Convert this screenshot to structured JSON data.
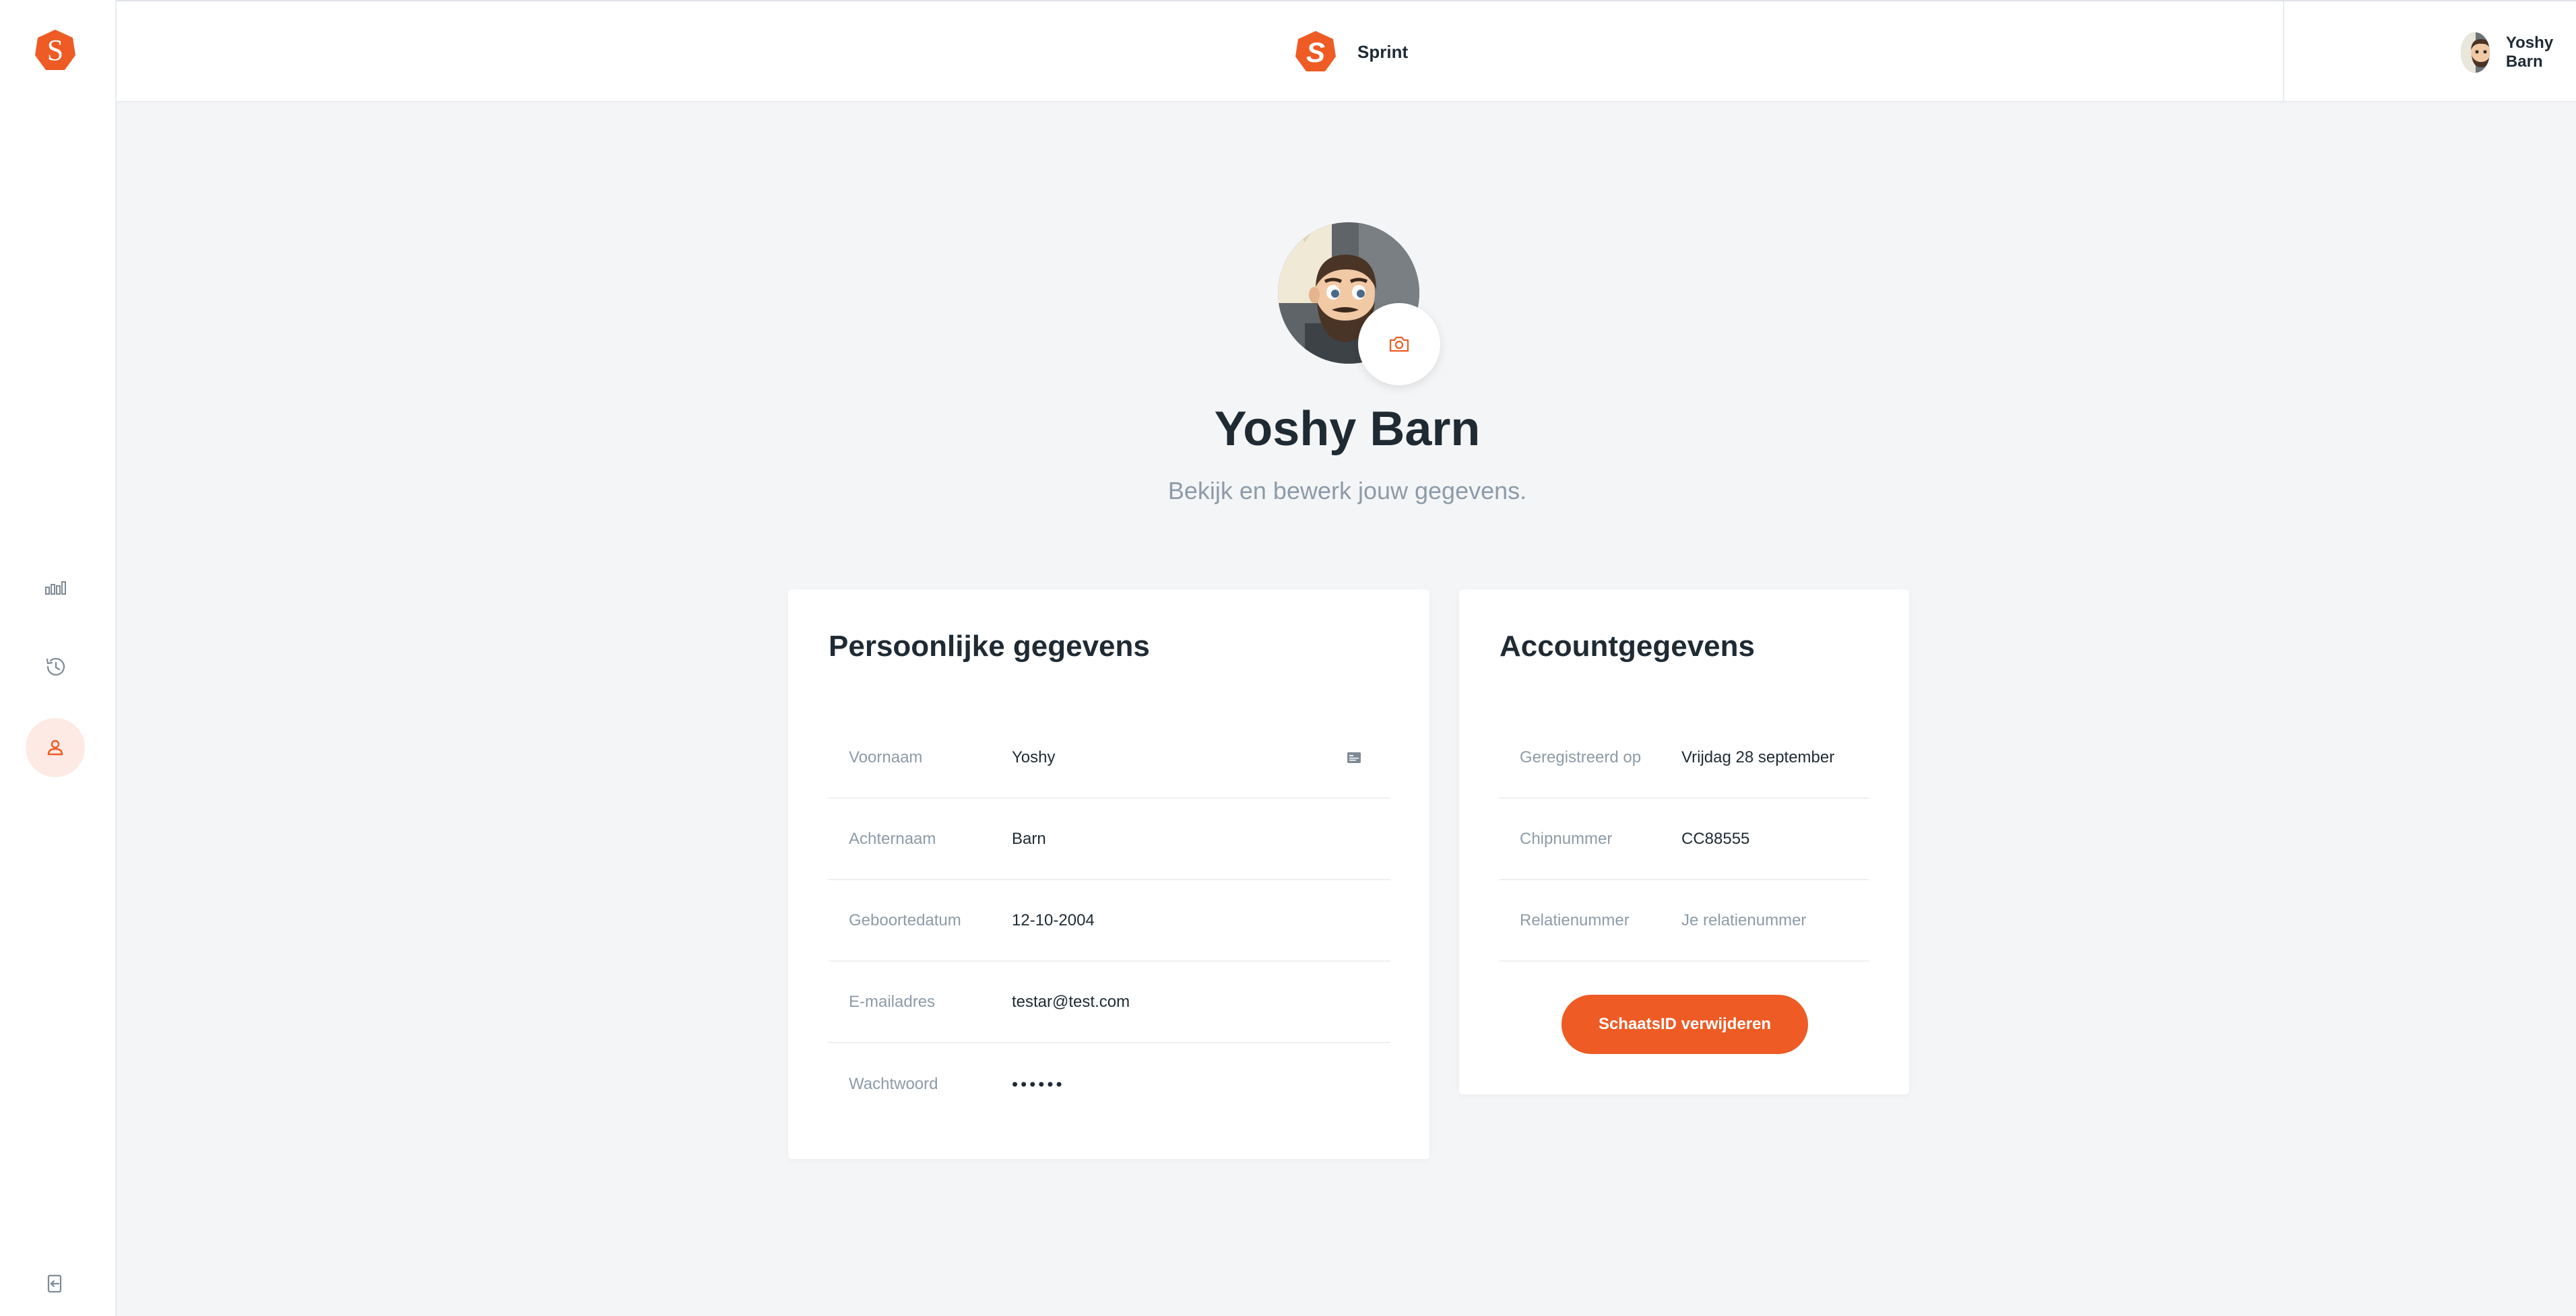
{
  "app": {
    "name": "Sprint"
  },
  "user": {
    "name": "Yoshy Barn"
  },
  "profile": {
    "name": "Yoshy Barn",
    "subtitle": "Bekijk en bewerk jouw gegevens."
  },
  "personal": {
    "title": "Persoonlijke gegevens",
    "rows": [
      {
        "label": "Voornaam",
        "value": "Yoshy"
      },
      {
        "label": "Achternaam",
        "value": "Barn"
      },
      {
        "label": "Geboortedatum",
        "value": "12-10-2004"
      },
      {
        "label": "E-mailadres",
        "value": "testar@test.com"
      },
      {
        "label": "Wachtwoord",
        "value": "••••••"
      }
    ]
  },
  "account": {
    "title": "Accountgegevens",
    "rows": [
      {
        "label": "Geregistreerd op",
        "value": "Vrijdag 28 september"
      },
      {
        "label": "Chipnummer",
        "value": "CC88555"
      },
      {
        "label": "Relatienummer",
        "placeholder": "Je relatienummer"
      }
    ],
    "delete_label": "SchaatsID verwijderen"
  },
  "sidebar": {
    "items": [
      {
        "icon": "bar-chart-icon"
      },
      {
        "icon": "history-icon"
      },
      {
        "icon": "user-icon",
        "active": true
      }
    ],
    "logout_icon": "logout-icon"
  },
  "colors": {
    "accent": "#ee5b24",
    "accent_soft": "#fdeae4",
    "background": "#f4f5f7",
    "muted_text": "#8d9ba8",
    "text": "#1f2a33"
  }
}
